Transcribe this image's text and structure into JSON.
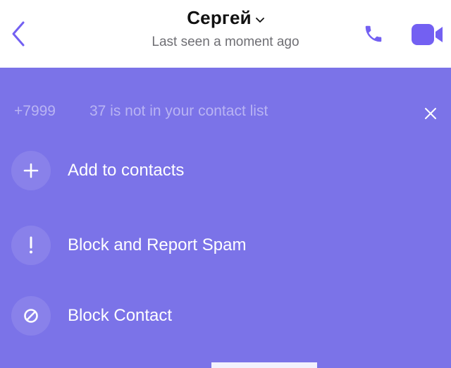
{
  "header": {
    "title": "Сергей",
    "subtitle": "Last seen a moment ago",
    "icons": {
      "back": "back-chevron-icon",
      "dropdown": "chevron-down-icon",
      "call": "phone-icon",
      "video": "video-camera-icon"
    }
  },
  "banner": {
    "number": "+7999",
    "message": "37 is not in your contact list",
    "close_icon": "close-icon"
  },
  "actions": [
    {
      "label": "Add to contacts",
      "icon": "plus-icon"
    },
    {
      "label": "Block and Report Spam",
      "icon": "exclamation-icon"
    },
    {
      "label": "Block Contact",
      "icon": "block-icon"
    }
  ],
  "colors": {
    "accent": "#7b73e8",
    "icon_accent": "#7360f2",
    "circle": "#8981ea",
    "notice_text": "#b9b4f3"
  }
}
